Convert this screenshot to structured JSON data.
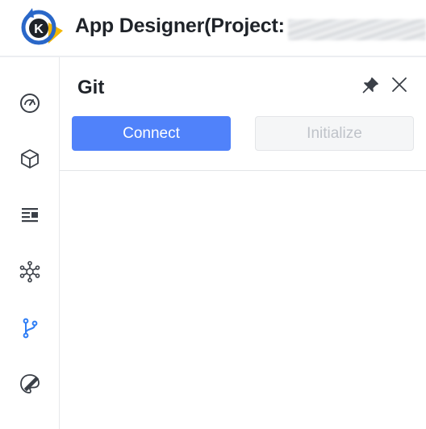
{
  "header": {
    "app_title": "App Designer(Project:",
    "logo_letter": "K"
  },
  "sidebar": {
    "items": [
      {
        "name": "dashboard-icon",
        "active": false
      },
      {
        "name": "cube-icon",
        "active": false
      },
      {
        "name": "list-icon",
        "active": false
      },
      {
        "name": "network-icon",
        "active": false
      },
      {
        "name": "git-branch-icon",
        "active": true
      },
      {
        "name": "palette-icon",
        "active": false
      }
    ]
  },
  "panel": {
    "title": "Git",
    "connect_label": "Connect",
    "initialize_label": "Initialize"
  },
  "colors": {
    "accent": "#5082fa",
    "active_icon": "#2f7ef5",
    "icon": "#3a3f47"
  }
}
